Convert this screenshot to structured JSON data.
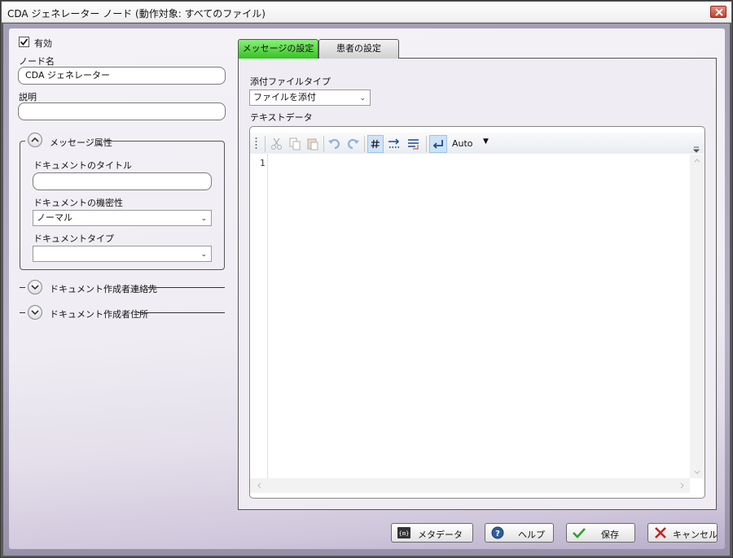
{
  "window": {
    "title": "CDA ジェネレーター ノード (動作対象: すべてのファイル)"
  },
  "left": {
    "enabled_label": "有効",
    "enabled_checked": true,
    "node_name_label": "ノード名",
    "node_name_value": "CDA ジェネレーター",
    "description_label": "説明",
    "description_value": "",
    "message_attributes": {
      "header": "メッセージ属性",
      "doc_title_label": "ドキュメントのタイトル",
      "doc_title_value": "",
      "confidentiality_label": "ドキュメントの機密性",
      "confidentiality_value": "ノーマル",
      "doc_type_label": "ドキュメントタイプ",
      "doc_type_value": ""
    },
    "author_contact_header": "ドキュメント作成者連絡先",
    "author_address_header": "ドキュメント作成者住所"
  },
  "tabs": [
    {
      "label": "メッセージの設定",
      "active": true
    },
    {
      "label": "患者の設定",
      "active": false
    }
  ],
  "message_settings": {
    "attachment_type_label": "添付ファイルタイプ",
    "attachment_type_value": "ファイルを添付",
    "text_data_label": "テキストデータ",
    "editor": {
      "wrap_mode_value": "Auto",
      "line_number": "1",
      "content": ""
    }
  },
  "buttons": {
    "metadata": "メタデータ",
    "help": "ヘルプ",
    "save": "保存",
    "cancel": "キャンセル"
  },
  "colors": {
    "active_tab": "#34c222",
    "close_button": "#c4402f",
    "toolbar_active": "#cfe3f7"
  },
  "icons": {
    "metadata": "metadata-icon",
    "help": "help-icon",
    "save": "checkmark-icon",
    "cancel": "x-icon"
  }
}
